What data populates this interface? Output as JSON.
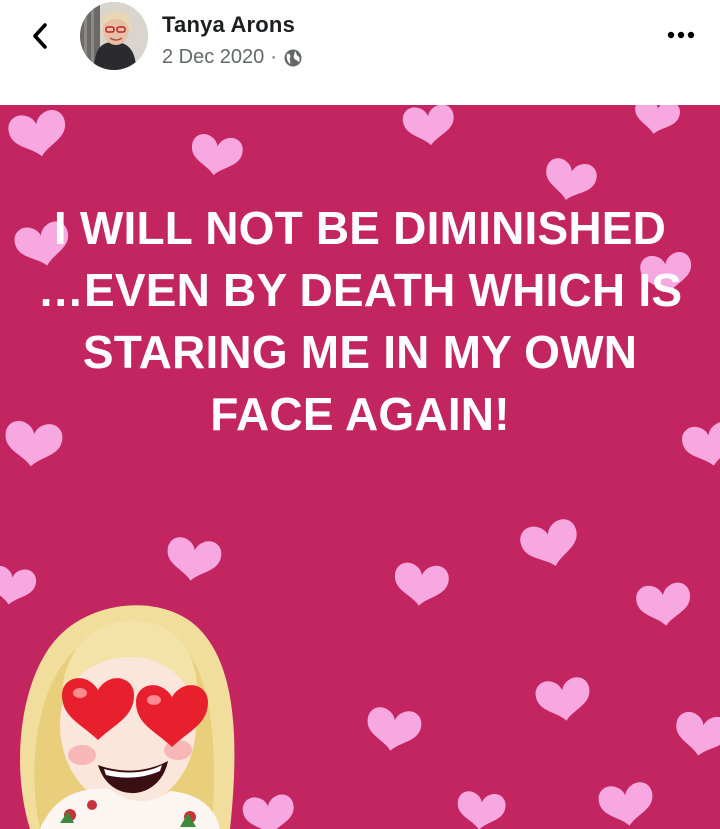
{
  "header": {
    "author_name": "Tanya Arons",
    "date": "2 Dec 2020",
    "separator": "·",
    "icons": {
      "back": "chevron-left-icon",
      "privacy": "globe-icon",
      "more": "more-dots-icon"
    }
  },
  "post": {
    "text": "I WILL NOT BE DIMINISHED …EVEN BY DEATH WHICH IS STARING ME IN MY OWN FACE AGAIN!",
    "background_color": "#c2255f",
    "heart_colors": [
      "#f7a8e0",
      "#f48ccf",
      "#ee79c3"
    ]
  }
}
